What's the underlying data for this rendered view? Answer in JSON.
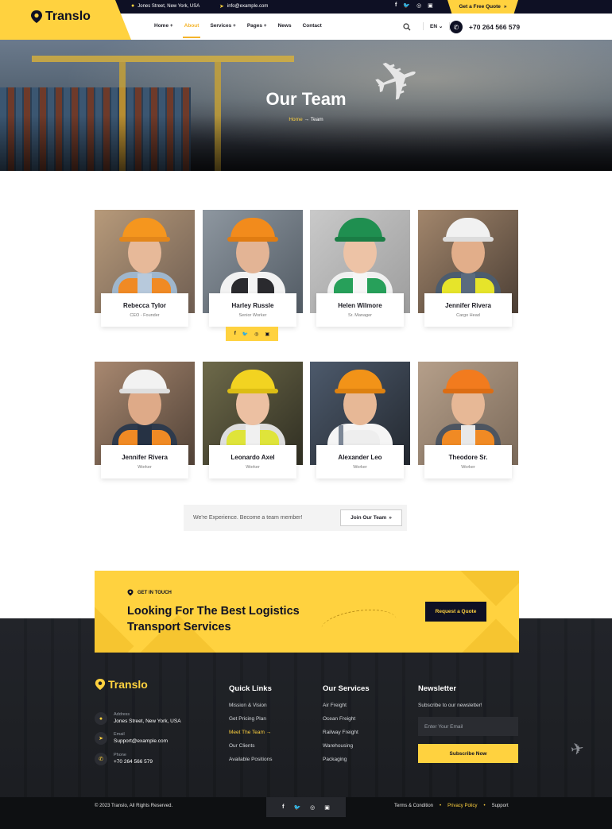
{
  "topbar": {
    "address": "Jones Street, New York, USA",
    "email": "info@example.com",
    "social": [
      "f",
      "t",
      "ig",
      "in"
    ],
    "quote_button": "Get a Free Quote"
  },
  "brand": {
    "name": "Translo",
    "accent": "#ffd23f",
    "dark": "#0e1024"
  },
  "nav": {
    "items": [
      "Home +",
      "About",
      "Services +",
      "Pages +",
      "News",
      "Contact"
    ],
    "active": "About",
    "language": "EN",
    "phone": "+70 264 566 579"
  },
  "hero": {
    "title": "Our Team",
    "breadcrumb_home": "Home",
    "breadcrumb_arrow": "→",
    "breadcrumb_current": "Team"
  },
  "team": [
    {
      "name": "Rebecca Tylor",
      "role": "CEO - Founder"
    },
    {
      "name": "Harley Russle",
      "role": "Senior Worker"
    },
    {
      "name": "Helen Wilmore",
      "role": "Sr. Manager"
    },
    {
      "name": "Jennifer Rivera",
      "role": "Cargo Head"
    },
    {
      "name": "Jennifer Rivera",
      "role": "Worker"
    },
    {
      "name": "Leonardo Axel",
      "role": "Worker"
    },
    {
      "name": "Alexander Leo",
      "role": "Worker"
    },
    {
      "name": "Theodore Sr.",
      "role": "Worker"
    }
  ],
  "card_social": [
    "f",
    "t",
    "ig",
    "in"
  ],
  "join": {
    "text": "We're Experience. Become a team member!",
    "button": "Join Our Team"
  },
  "cta": {
    "tag": "GET IN TOUCH",
    "heading": "Looking For The Best Logistics Transport Services",
    "button": "Request a Quote"
  },
  "footer": {
    "logo": "Translo",
    "contacts": [
      {
        "label": "Address",
        "value": "Jones Street, New York, USA",
        "icon": "pin-icon"
      },
      {
        "label": "Email",
        "value": "Support@example.com",
        "icon": "send-icon"
      },
      {
        "label": "Phone",
        "value": "+70 264 566 579",
        "icon": "phone-icon"
      }
    ],
    "quick_links_title": "Quick Links",
    "quick_links": [
      "Mission & Vision",
      "Get Pricing Plan",
      "Meet The Team",
      "Our Clients",
      "Available Positions"
    ],
    "quick_links_active": "Meet The Team",
    "services_title": "Our Services",
    "services": [
      "Air Freight",
      "Ocean Freight",
      "Railway Freight",
      "Warehousing",
      "Packaging"
    ],
    "newsletter_title": "Newsletter",
    "newsletter_text": "Subscribe to our newsletter!",
    "email_placeholder": "Enter Your Email",
    "subscribe_button": "Subscribe Now",
    "copyright": "© 2023 Translo, All Rights Reserved.",
    "legal": [
      "Terms & Condition",
      "Privacy Policy",
      "Support"
    ],
    "legal_active": "Privacy Policy"
  }
}
